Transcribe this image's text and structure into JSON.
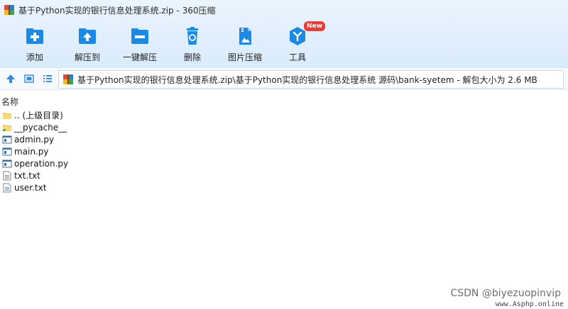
{
  "window": {
    "title": "基于Python实现的银行信息处理系统.zip - 360压缩"
  },
  "toolbar": {
    "items": [
      {
        "label": "添加",
        "icon": "add-icon"
      },
      {
        "label": "解压到",
        "icon": "extract-to-icon"
      },
      {
        "label": "一键解压",
        "icon": "one-click-extract-icon"
      },
      {
        "label": "删除",
        "icon": "delete-icon"
      },
      {
        "label": "图片压缩",
        "icon": "image-compress-icon"
      },
      {
        "label": "工具",
        "icon": "tools-icon",
        "badge": "New"
      }
    ]
  },
  "address": {
    "path": "基于Python实现的银行信息处理系统.zip\\基于Python实现的银行信息处理系统 源码\\bank-syetem - 解包大小为 2.6 MB"
  },
  "list": {
    "column_name": "名称",
    "items": [
      {
        "name": ".. (上级目录)",
        "icon": "folder-icon"
      },
      {
        "name": "__pycache__",
        "icon": "folder-icon"
      },
      {
        "name": "admin.py",
        "icon": "python-file-icon"
      },
      {
        "name": "main.py",
        "icon": "python-file-icon"
      },
      {
        "name": "operation.py",
        "icon": "python-file-icon"
      },
      {
        "name": "txt.txt",
        "icon": "text-file-icon"
      },
      {
        "name": "user.txt",
        "icon": "text-file-icon"
      }
    ]
  },
  "watermark": {
    "line1": "CSDN @biyezuopinvip",
    "line2": "www.Asphp.online"
  },
  "colors": {
    "accent": "#1a8ae6",
    "badge": "#f03a2f"
  }
}
